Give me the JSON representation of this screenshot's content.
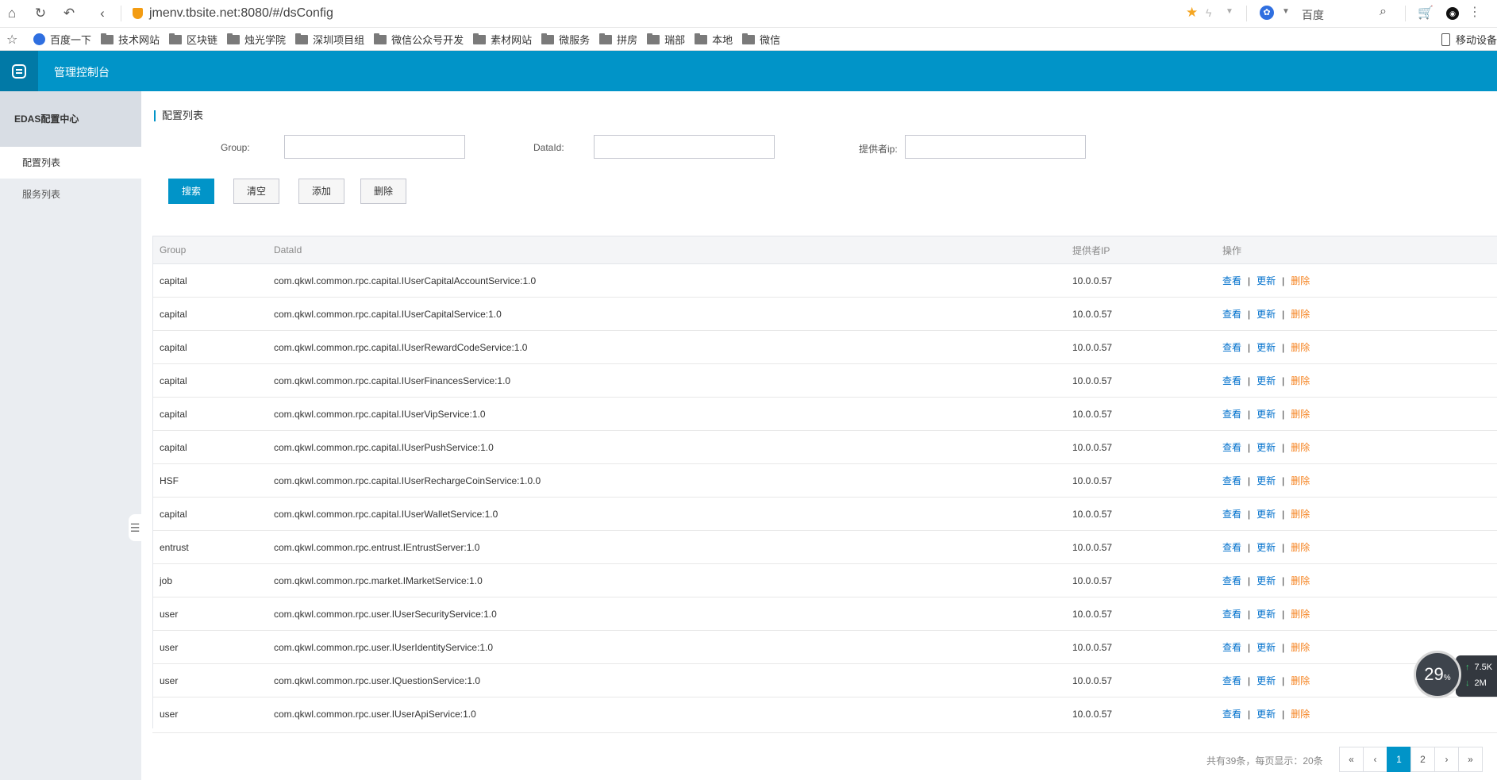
{
  "browser": {
    "url": "jmenv.tbsite.net:8080/#/dsConfig",
    "search_engine": "百度",
    "bookmarks": [
      {
        "label": "百度一下",
        "icon": "baidu-paw-icon"
      },
      {
        "label": "技术网站",
        "icon": "folder-icon"
      },
      {
        "label": "区块链",
        "icon": "folder-icon"
      },
      {
        "label": "烛光学院",
        "icon": "folder-icon"
      },
      {
        "label": "深圳项目组",
        "icon": "folder-icon"
      },
      {
        "label": "微信公众号开发",
        "icon": "folder-icon"
      },
      {
        "label": "素材网站",
        "icon": "folder-icon"
      },
      {
        "label": "微服务",
        "icon": "folder-icon"
      },
      {
        "label": "拼房",
        "icon": "folder-icon"
      },
      {
        "label": "瑞部",
        "icon": "folder-icon"
      },
      {
        "label": "本地",
        "icon": "folder-icon"
      },
      {
        "label": "微信",
        "icon": "folder-icon"
      }
    ],
    "mobile_bookmark": "移动设备"
  },
  "header": {
    "title": "管理控制台"
  },
  "sidebar": {
    "section": "EDAS配置中心",
    "items": [
      {
        "label": "配置列表",
        "active": true
      },
      {
        "label": "服务列表",
        "active": false
      }
    ]
  },
  "main": {
    "title": "配置列表",
    "filters": {
      "group_label": "Group",
      "dataid_label": "DataId",
      "provider_label": "提供者ip",
      "group_value": "",
      "dataid_value": "",
      "provider_value": ""
    },
    "buttons": {
      "search": "搜索",
      "clear": "清空",
      "add": "添加",
      "delete": "删除"
    },
    "table": {
      "columns": [
        "Group",
        "DataId",
        "提供者IP",
        "操作"
      ],
      "ops": {
        "view": "查看",
        "update": "更新",
        "delete": "删除",
        "sep": "|"
      },
      "rows": [
        {
          "group": "capital",
          "dataid": "com.qkwl.common.rpc.capital.IUserCapitalAccountService:1.0",
          "ip": "10.0.0.57"
        },
        {
          "group": "capital",
          "dataid": "com.qkwl.common.rpc.capital.IUserCapitalService:1.0",
          "ip": "10.0.0.57"
        },
        {
          "group": "capital",
          "dataid": "com.qkwl.common.rpc.capital.IUserRewardCodeService:1.0",
          "ip": "10.0.0.57"
        },
        {
          "group": "capital",
          "dataid": "com.qkwl.common.rpc.capital.IUserFinancesService:1.0",
          "ip": "10.0.0.57"
        },
        {
          "group": "capital",
          "dataid": "com.qkwl.common.rpc.capital.IUserVipService:1.0",
          "ip": "10.0.0.57"
        },
        {
          "group": "capital",
          "dataid": "com.qkwl.common.rpc.capital.IUserPushService:1.0",
          "ip": "10.0.0.57"
        },
        {
          "group": "HSF",
          "dataid": "com.qkwl.common.rpc.capital.IUserRechargeCoinService:1.0.0",
          "ip": "10.0.0.57"
        },
        {
          "group": "capital",
          "dataid": "com.qkwl.common.rpc.capital.IUserWalletService:1.0",
          "ip": "10.0.0.57"
        },
        {
          "group": "entrust",
          "dataid": "com.qkwl.common.rpc.entrust.IEntrustServer:1.0",
          "ip": "10.0.0.57"
        },
        {
          "group": "job",
          "dataid": "com.qkwl.common.rpc.market.IMarketService:1.0",
          "ip": "10.0.0.57"
        },
        {
          "group": "user",
          "dataid": "com.qkwl.common.rpc.user.IUserSecurityService:1.0",
          "ip": "10.0.0.57"
        },
        {
          "group": "user",
          "dataid": "com.qkwl.common.rpc.user.IUserIdentityService:1.0",
          "ip": "10.0.0.57"
        },
        {
          "group": "user",
          "dataid": "com.qkwl.common.rpc.user.IQuestionService:1.0",
          "ip": "10.0.0.57"
        },
        {
          "group": "user",
          "dataid": "com.qkwl.common.rpc.user.IUserApiService:1.0",
          "ip": "10.0.0.57"
        }
      ]
    },
    "pagination": {
      "summary": "共有39条，每页显示：20条",
      "first": "«",
      "prev": "‹",
      "pages": [
        "1",
        "2"
      ],
      "current": "1",
      "next": "›",
      "last": "»"
    }
  },
  "speed_widget": {
    "percent": "29",
    "percent_unit": "%",
    "up": "7.5K",
    "down": "2M"
  },
  "colors": {
    "header": "#0194c8",
    "link": "#0070cc",
    "delete": "#f5821f"
  }
}
